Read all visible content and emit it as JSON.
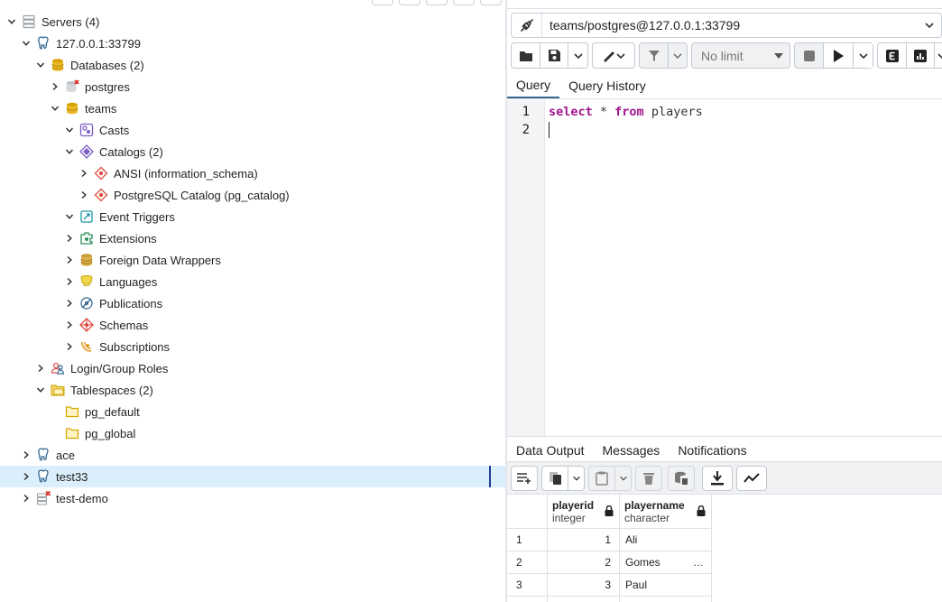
{
  "tree": {
    "items": [
      {
        "label": "Servers (4)",
        "indent": 0,
        "toggle": "down",
        "icon": "servers-icon"
      },
      {
        "label": "127.0.0.1:33799",
        "indent": 1,
        "toggle": "down",
        "icon": "postgres-elephant-icon"
      },
      {
        "label": "Databases (2)",
        "indent": 2,
        "toggle": "down",
        "icon": "databases-icon"
      },
      {
        "label": "postgres",
        "indent": 3,
        "toggle": "right",
        "icon": "database-disconnected-icon"
      },
      {
        "label": "teams",
        "indent": 3,
        "toggle": "down",
        "icon": "database-icon"
      },
      {
        "label": "Casts",
        "indent": 4,
        "toggle": "down",
        "icon": "casts-icon"
      },
      {
        "label": "Catalogs (2)",
        "indent": 4,
        "toggle": "down",
        "icon": "catalogs-icon"
      },
      {
        "label": "ANSI (information_schema)",
        "indent": 5,
        "toggle": "right",
        "icon": "catalog-icon"
      },
      {
        "label": "PostgreSQL Catalog (pg_catalog)",
        "indent": 5,
        "toggle": "right",
        "icon": "catalog-icon"
      },
      {
        "label": "Event Triggers",
        "indent": 4,
        "toggle": "down",
        "icon": "event-triggers-icon"
      },
      {
        "label": "Extensions",
        "indent": 4,
        "toggle": "right",
        "icon": "extensions-icon"
      },
      {
        "label": "Foreign Data Wrappers",
        "indent": 4,
        "toggle": "right",
        "icon": "foreign-data-wrappers-icon"
      },
      {
        "label": "Languages",
        "indent": 4,
        "toggle": "right",
        "icon": "languages-icon"
      },
      {
        "label": "Publications",
        "indent": 4,
        "toggle": "right",
        "icon": "publications-icon"
      },
      {
        "label": "Schemas",
        "indent": 4,
        "toggle": "right",
        "icon": "schemas-icon"
      },
      {
        "label": "Subscriptions",
        "indent": 4,
        "toggle": "right",
        "icon": "subscriptions-icon"
      },
      {
        "label": "Login/Group Roles",
        "indent": 2,
        "toggle": "right",
        "icon": "roles-icon"
      },
      {
        "label": "Tablespaces (2)",
        "indent": 2,
        "toggle": "down",
        "icon": "tablespaces-icon"
      },
      {
        "label": "pg_default",
        "indent": 3,
        "toggle": "none",
        "icon": "tablespace-icon"
      },
      {
        "label": "pg_global",
        "indent": 3,
        "toggle": "none",
        "icon": "tablespace-icon"
      },
      {
        "label": "ace",
        "indent": 1,
        "toggle": "right",
        "icon": "postgres-elephant-icon"
      },
      {
        "label": "test33",
        "indent": 1,
        "toggle": "right",
        "icon": "postgres-elephant-icon",
        "selected": true
      },
      {
        "label": "test-demo",
        "indent": 1,
        "toggle": "right",
        "icon": "server-disconnected-icon"
      }
    ]
  },
  "query_tool": {
    "connection": "teams/postgres@127.0.0.1:33799",
    "limit_label": "No limit",
    "tabs": [
      "Query",
      "Query History"
    ],
    "active_tab": "Query",
    "editor": {
      "lines": [
        {
          "number": "1",
          "keyword1": "select",
          "star": " * ",
          "keyword2": "from",
          "rest": " players"
        },
        {
          "number": "2"
        }
      ]
    },
    "output_tabs": [
      "Data Output",
      "Messages",
      "Notifications"
    ],
    "active_output_tab": "Data Output",
    "columns": [
      {
        "name": "playerid",
        "type": "integer"
      },
      {
        "name": "playername",
        "type": "character"
      }
    ],
    "rows": [
      {
        "row": "1",
        "playerid": "1",
        "playername": "Ali",
        "truncated": ""
      },
      {
        "row": "2",
        "playerid": "2",
        "playername": "Gomes",
        "truncated": "…"
      },
      {
        "row": "3",
        "playerid": "3",
        "playername": "Paul",
        "truncated": ""
      }
    ]
  },
  "colors": {
    "selected_row": "#dbeefb",
    "tab_underline": "#326690",
    "sql_keyword": "#a0158c",
    "icon_amber": "#d9a200",
    "icon_blue": "#336791",
    "icon_purple": "#7a5bc7",
    "icon_red": "#e04b3c",
    "icon_green": "#2f8f5b",
    "icon_teal": "#1b94a8"
  }
}
